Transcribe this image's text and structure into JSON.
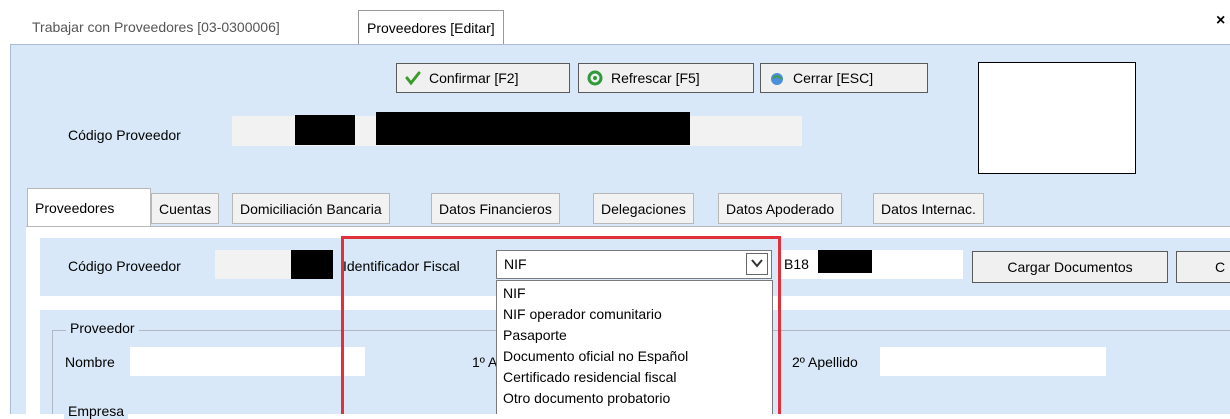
{
  "window": {
    "doc_tabs": [
      "Trabajar con Proveedores  [03-0300006]",
      "Proveedores [Editar]"
    ],
    "close_glyph": "×"
  },
  "toolbar": {
    "confirm_label": "Confirmar [F2]",
    "refresh_label": "Refrescar [F5]",
    "close_label": "Cerrar [ESC]"
  },
  "header": {
    "code_label": "Código Proveedor"
  },
  "section_tabs": [
    "Proveedores",
    "Cuentas",
    "Domiciliación Bancaria",
    "Datos Financieros",
    "Delegaciones",
    "Datos Apoderado",
    "Datos Internac."
  ],
  "form": {
    "code_label": "Código Proveedor",
    "fiscal_label": "Identificador Fiscal",
    "fiscal_selected": "NIF",
    "nif_value": "B18",
    "cargar_label": "Cargar Documentos",
    "cut_button_label": "C",
    "proveedor_group": "Proveedor",
    "nombre_label": "Nombre",
    "apellido1_label": "1º A",
    "apellido2_label": "2º Apellido",
    "empresa_group": "Empresa"
  },
  "dropdown_options": [
    "NIF",
    "NIF operador comunitario",
    "Pasaporte",
    "Documento oficial no Español",
    "Certificado residencial fiscal",
    "Otro documento probatorio"
  ],
  "colors": {
    "panel_blue": "#d8e8f8",
    "highlight_red": "#e0303a"
  }
}
